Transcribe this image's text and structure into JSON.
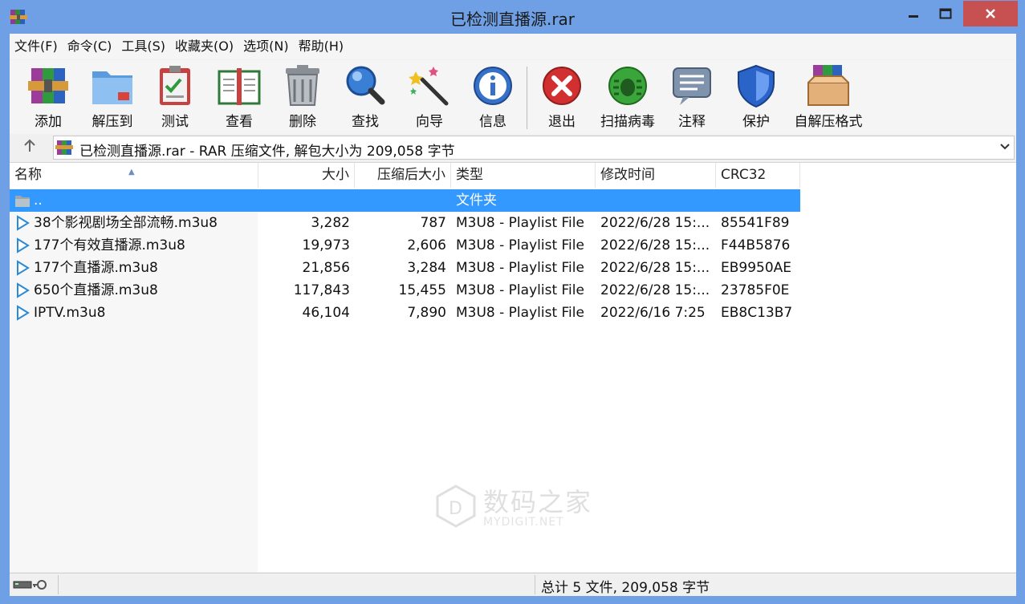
{
  "window": {
    "title": "已检测直播源.rar"
  },
  "menu": [
    {
      "label": "文件(F)"
    },
    {
      "label": "命令(C)"
    },
    {
      "label": "工具(S)"
    },
    {
      "label": "收藏夹(O)"
    },
    {
      "label": "选项(N)"
    },
    {
      "label": "帮助(H)"
    }
  ],
  "toolbar": {
    "add": "添加",
    "extract": "解压到",
    "test": "测试",
    "view": "查看",
    "delete": "删除",
    "find": "查找",
    "wizard": "向导",
    "info": "信息",
    "exit": "退出",
    "virus": "扫描病毒",
    "comment": "注释",
    "protect": "保护",
    "sfx": "自解压格式"
  },
  "address": {
    "text": "已检测直播源.rar - RAR 压缩文件, 解包大小为 209,058 字节"
  },
  "columns": {
    "name": "名称",
    "size": "大小",
    "packed": "压缩后大小",
    "type": "类型",
    "modified": "修改时间",
    "crc": "CRC32"
  },
  "rows": [
    {
      "name": "..",
      "size": "",
      "packed": "",
      "type": "文件夹",
      "modified": "",
      "crc": ""
    },
    {
      "name": "38个影视剧场全部流畅.m3u8",
      "size": "3,282",
      "packed": "787",
      "type": "M3U8 - Playlist File",
      "modified": "2022/6/28 15:...",
      "crc": "85541F89"
    },
    {
      "name": "177个有效直播源.m3u8",
      "size": "19,973",
      "packed": "2,606",
      "type": "M3U8 - Playlist File",
      "modified": "2022/6/28 15:...",
      "crc": "F44B5876"
    },
    {
      "name": "177个直播源.m3u8",
      "size": "21,856",
      "packed": "3,284",
      "type": "M3U8 - Playlist File",
      "modified": "2022/6/28 15:...",
      "crc": "EB9950AE"
    },
    {
      "name": "650个直播源.m3u8",
      "size": "117,843",
      "packed": "15,455",
      "type": "M3U8 - Playlist File",
      "modified": "2022/6/28 15:...",
      "crc": "23785F0E"
    },
    {
      "name": "IPTV.m3u8",
      "size": "46,104",
      "packed": "7,890",
      "type": "M3U8 - Playlist File",
      "modified": "2022/6/16 7:25",
      "crc": "EB8C13B7"
    }
  ],
  "watermark": {
    "main": "数码之家",
    "sub": "MYDIGIT.NET"
  },
  "status": {
    "text": "总计 5 文件, 209,058 字节"
  },
  "colors": {
    "selection": "#3399ff",
    "titlebar": "#6fa0e6",
    "close": "#c75050"
  }
}
